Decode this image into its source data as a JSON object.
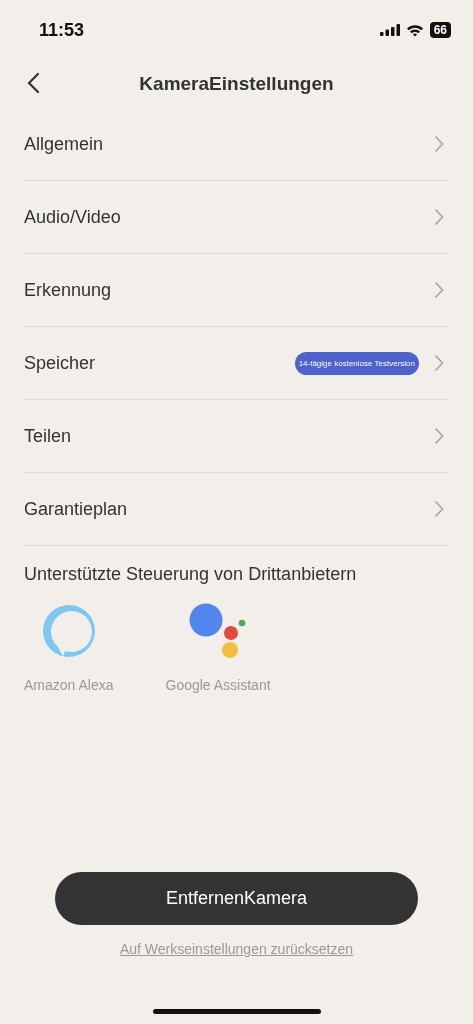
{
  "status_bar": {
    "time": "11:53",
    "battery": "66"
  },
  "header": {
    "title": "KameraEinstellungen"
  },
  "menu_items": [
    {
      "label": "Allgemein"
    },
    {
      "label": "Audio/Video"
    },
    {
      "label": "Erkennung"
    },
    {
      "label": "Speicher",
      "badge": "14-tägige kostenlose Testversion"
    },
    {
      "label": "Teilen"
    },
    {
      "label": "Garantieplan"
    }
  ],
  "integrations": {
    "title": "Unterstützte Steuerung von Drittanbietern",
    "items": [
      {
        "kind": "alexa",
        "label": "Amazon Alexa"
      },
      {
        "kind": "assistant",
        "label": "Google Assistant"
      }
    ]
  },
  "remove_button": "EntfernenKamera",
  "reset_link": "Auf Werkseinstellungen zurücksetzen"
}
